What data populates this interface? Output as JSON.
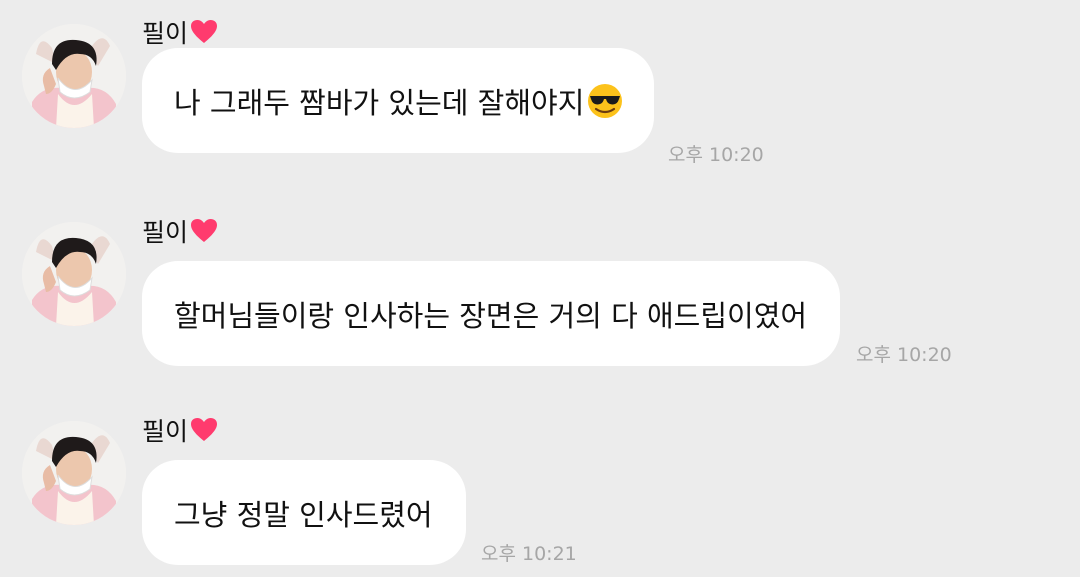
{
  "messages": [
    {
      "sender": "필이",
      "text": "나 그래두 짬바가 있는데 잘해야지",
      "emoji": "smiling-face-with-sunglasses",
      "time": "오후 10:20"
    },
    {
      "sender": "필이",
      "text": "할머님들이랑 인사하는 장면은 거의 다 애드립이였어",
      "time": "오후 10:20"
    },
    {
      "sender": "필이",
      "text": "그냥 정말 인사드렸어",
      "time": "오후 10:21"
    }
  ],
  "icons": {
    "heart": "heart-icon",
    "avatar": "profile-avatar"
  },
  "colors": {
    "background": "#ececec",
    "bubble": "#ffffff",
    "timestamp": "#a6a6a6",
    "heart": "#ff3b6e"
  }
}
